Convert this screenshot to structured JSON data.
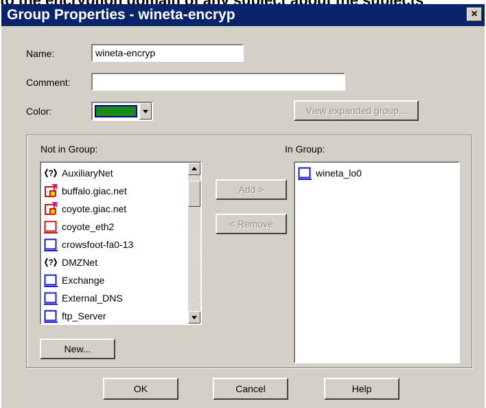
{
  "background_text": "to the encryption domain of any subject about the subjects",
  "dialog": {
    "title": "Group Properties - wineta-encryp",
    "close_label": "×"
  },
  "form": {
    "name_label": "Name:",
    "name_value": "wineta-encryp",
    "comment_label": "Comment:",
    "comment_value": "",
    "color_label": "Color:",
    "color_value": "#1a8a1a",
    "view_expanded_label": "View expanded group..."
  },
  "not_in_group": {
    "label": "Not in Group:",
    "items": [
      {
        "name": "AuxiliaryNet",
        "icon": "network-icon"
      },
      {
        "name": "buffalo.giac.net",
        "icon": "gateway-icon"
      },
      {
        "name": "coyote.giac.net",
        "icon": "gateway-icon"
      },
      {
        "name": "coyote_eth2",
        "icon": "interface-red-icon"
      },
      {
        "name": "crowsfoot-fa0-13",
        "icon": "host-icon"
      },
      {
        "name": "DMZNet",
        "icon": "network-icon"
      },
      {
        "name": "Exchange",
        "icon": "host-icon"
      },
      {
        "name": "External_DNS",
        "icon": "host-icon"
      },
      {
        "name": "ftp_Server",
        "icon": "host-icon"
      }
    ]
  },
  "buttons": {
    "add_label": "Add  >",
    "remove_label": "<  Remove",
    "new_label": "New...",
    "ok_label": "OK",
    "cancel_label": "Cancel",
    "help_label": "Help"
  },
  "in_group": {
    "label": "In Group:",
    "items": [
      {
        "name": "wineta_lo0",
        "icon": "host-icon"
      }
    ]
  }
}
